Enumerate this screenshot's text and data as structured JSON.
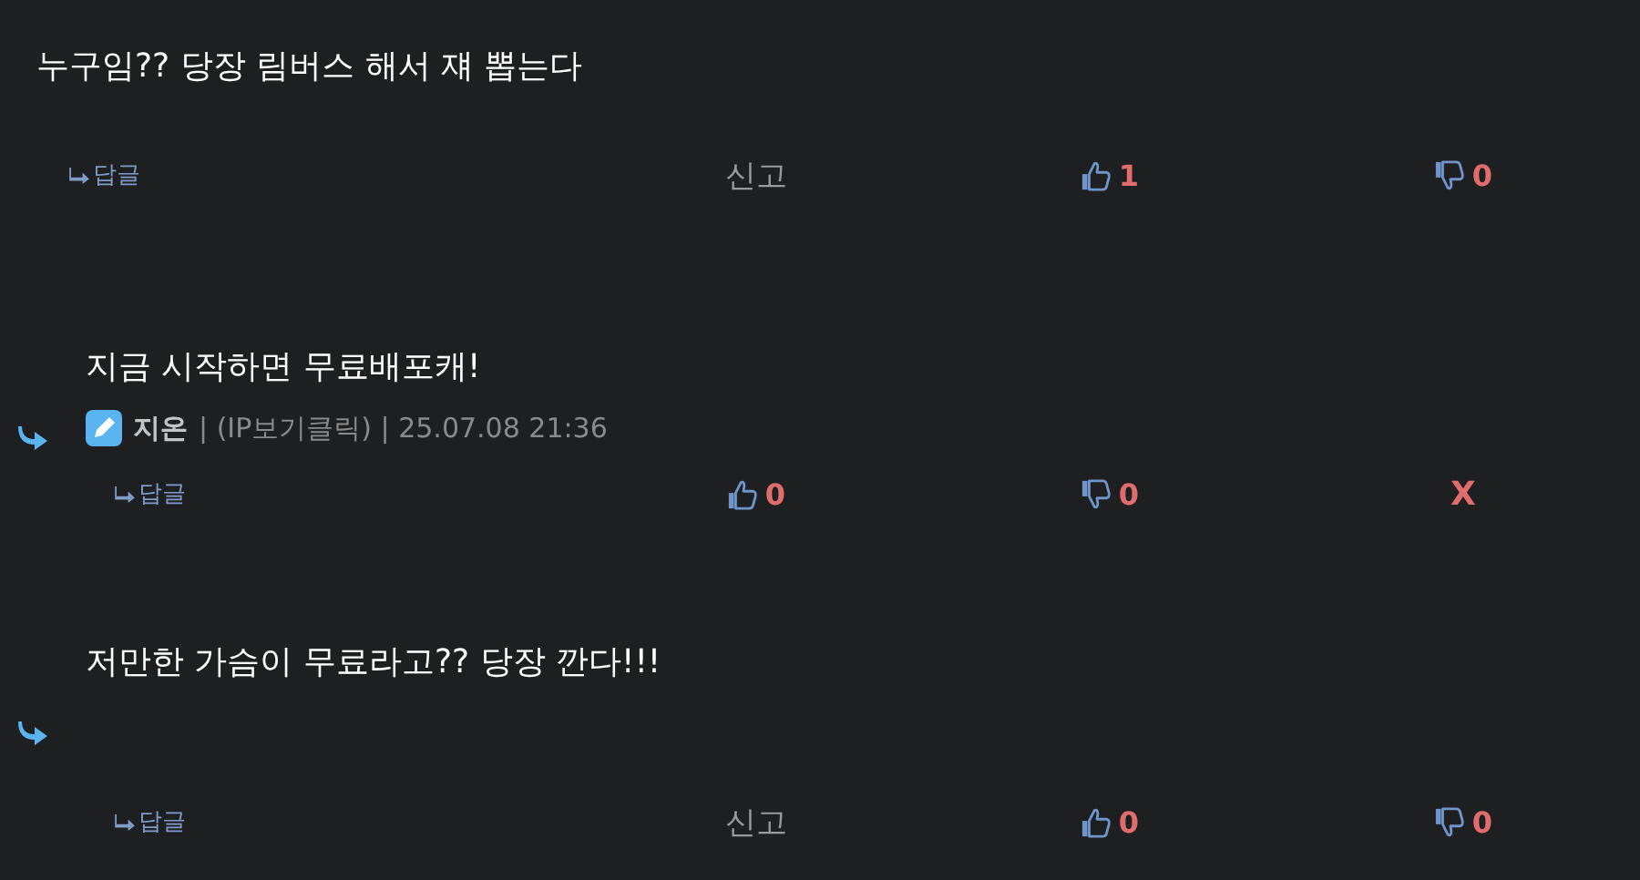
{
  "comments": [
    {
      "kind": "comment",
      "text": "누구임?? 당장 림버스 해서 쟤 뽑는다",
      "actions": [
        {
          "kind": "reply",
          "label": "답글"
        },
        {
          "kind": "report",
          "label": "신고"
        },
        {
          "kind": "like",
          "count": "1"
        },
        {
          "kind": "dislike",
          "count": "0"
        }
      ]
    },
    {
      "kind": "reply",
      "text": "지금 시작하면 무료배포캐!",
      "author": "지온",
      "meta": "| (IP보기클릭) | 25.07.08 21:36",
      "actions": [
        {
          "kind": "reply",
          "label": "답글"
        },
        {
          "kind": "like",
          "count": "0"
        },
        {
          "kind": "dislike",
          "count": "0"
        },
        {
          "kind": "delete",
          "label": "X"
        }
      ]
    },
    {
      "kind": "reply",
      "text": "저만한 가슴이 무료라고?? 당장 깐다!!!",
      "actions": [
        {
          "kind": "reply",
          "label": "답글"
        },
        {
          "kind": "report",
          "label": "신고"
        },
        {
          "kind": "like",
          "count": "0"
        },
        {
          "kind": "dislike",
          "count": "0"
        }
      ]
    }
  ]
}
